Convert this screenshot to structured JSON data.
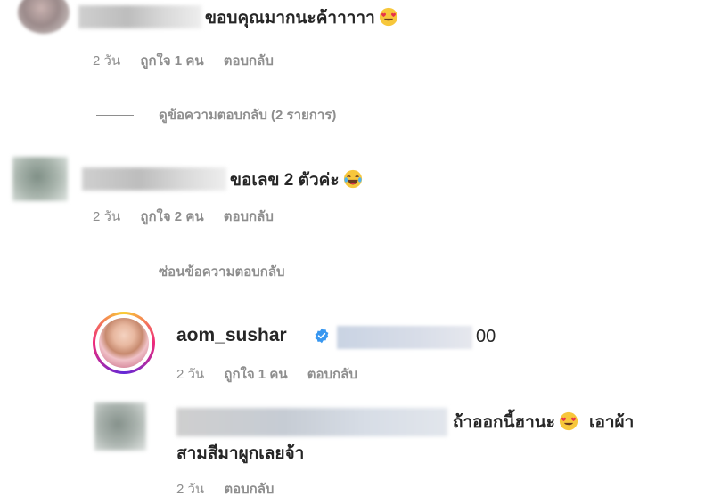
{
  "comments": [
    {
      "text": "ขอบคุณมากนะค้าาาาา",
      "emoji": "heart-eyes-emoji",
      "meta": {
        "time": "2 วัน",
        "likes": "ถูกใจ 1 คน",
        "reply": "ตอบกลับ"
      },
      "replies_toggle": "ดูข้อความตอบกลับ (2 รายการ)"
    },
    {
      "text": "ขอเลข 2 ตัวค่ะ",
      "emoji": "laughing-tears-emoji",
      "meta": {
        "time": "2 วัน",
        "likes": "ถูกใจ 2 คน",
        "reply": "ตอบกลับ"
      },
      "replies_toggle": "ซ่อนข้อความตอบกลับ"
    }
  ],
  "replies": [
    {
      "username": "aom_sushar",
      "verified": true,
      "text_suffix": "00",
      "meta": {
        "time": "2 วัน",
        "likes": "ถูกใจ 1 คน",
        "reply": "ตอบกลับ"
      }
    },
    {
      "text_line1": "ถ้าออกนี้ฮานะ",
      "text_line1_after": "เอาผ้า",
      "text_line2": "สามสีมาผูกเลยจ้า",
      "emoji": "heart-eyes-emoji",
      "meta": {
        "time": "2 วัน",
        "reply": "ตอบกลับ"
      }
    }
  ],
  "colors": {
    "text": "#262626",
    "meta": "#8e8e8e",
    "verified": "#3897f0"
  }
}
